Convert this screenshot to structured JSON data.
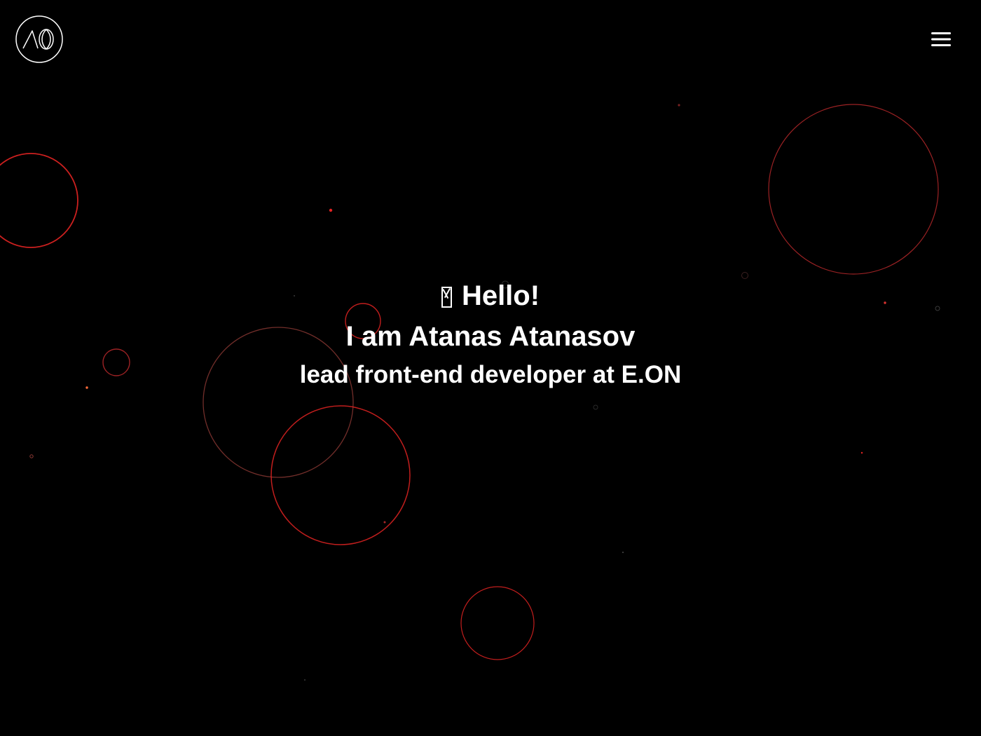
{
  "header": {
    "logo_icon": "monogram-circle-icon",
    "menu_icon": "hamburger-menu-icon"
  },
  "hero": {
    "greeting_icon": "waving-hand-emoji-icon",
    "greeting": "Hello!",
    "intro": "I am Atanas Atanasov",
    "role": "lead front-end developer at E.ON"
  },
  "colors": {
    "background": "#000000",
    "text": "#ffffff",
    "accent_red": "#e32322",
    "accent_orange": "#ff6b3a"
  }
}
